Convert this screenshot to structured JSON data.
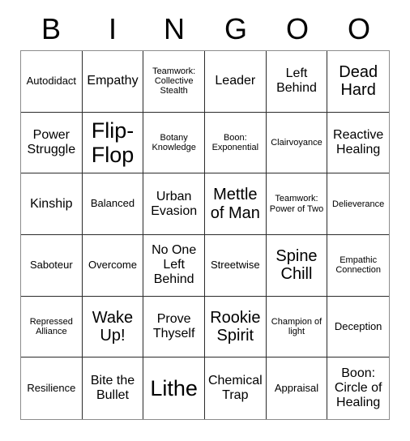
{
  "card": {
    "header_letters": [
      "B",
      "I",
      "N",
      "G",
      "O",
      "O"
    ],
    "columns": 6,
    "rows": 6,
    "grid_line_color": "#2b2b2b",
    "background_color": "#ffffff",
    "text_color": "#000000",
    "cells": [
      {
        "text": "Autodidact",
        "size": "s"
      },
      {
        "text": "Empathy",
        "size": "m"
      },
      {
        "text": "Teamwork: Collective Stealth",
        "size": "xs"
      },
      {
        "text": "Leader",
        "size": "m"
      },
      {
        "text": "Left Behind",
        "size": "m"
      },
      {
        "text": "Dead Hard",
        "size": "l"
      },
      {
        "text": "Power Struggle",
        "size": "m"
      },
      {
        "text": "Flip-Flop",
        "size": "xl"
      },
      {
        "text": "Botany Knowledge",
        "size": "xs"
      },
      {
        "text": "Boon: Exponential",
        "size": "xs"
      },
      {
        "text": "Clairvoyance",
        "size": "xs"
      },
      {
        "text": "Reactive Healing",
        "size": "m"
      },
      {
        "text": "Kinship",
        "size": "m"
      },
      {
        "text": "Balanced",
        "size": "s"
      },
      {
        "text": "Urban Evasion",
        "size": "m"
      },
      {
        "text": "Mettle of Man",
        "size": "l"
      },
      {
        "text": "Teamwork: Power of Two",
        "size": "xs"
      },
      {
        "text": "Delieverance",
        "size": "xs"
      },
      {
        "text": "Saboteur",
        "size": "s"
      },
      {
        "text": "Overcome",
        "size": "s"
      },
      {
        "text": "No One Left Behind",
        "size": "m"
      },
      {
        "text": "Streetwise",
        "size": "s"
      },
      {
        "text": "Spine Chill",
        "size": "l"
      },
      {
        "text": "Empathic Connection",
        "size": "xs"
      },
      {
        "text": "Repressed Alliance",
        "size": "xs"
      },
      {
        "text": "Wake Up!",
        "size": "l"
      },
      {
        "text": "Prove Thyself",
        "size": "m"
      },
      {
        "text": "Rookie Spirit",
        "size": "l"
      },
      {
        "text": "Champion of light",
        "size": "xs"
      },
      {
        "text": "Deception",
        "size": "s"
      },
      {
        "text": "Resilience",
        "size": "s"
      },
      {
        "text": "Bite the Bullet",
        "size": "m"
      },
      {
        "text": "Lithe",
        "size": "xl"
      },
      {
        "text": "Chemical Trap",
        "size": "m"
      },
      {
        "text": "Appraisal",
        "size": "s"
      },
      {
        "text": "Boon: Circle of Healing",
        "size": "m"
      }
    ]
  }
}
